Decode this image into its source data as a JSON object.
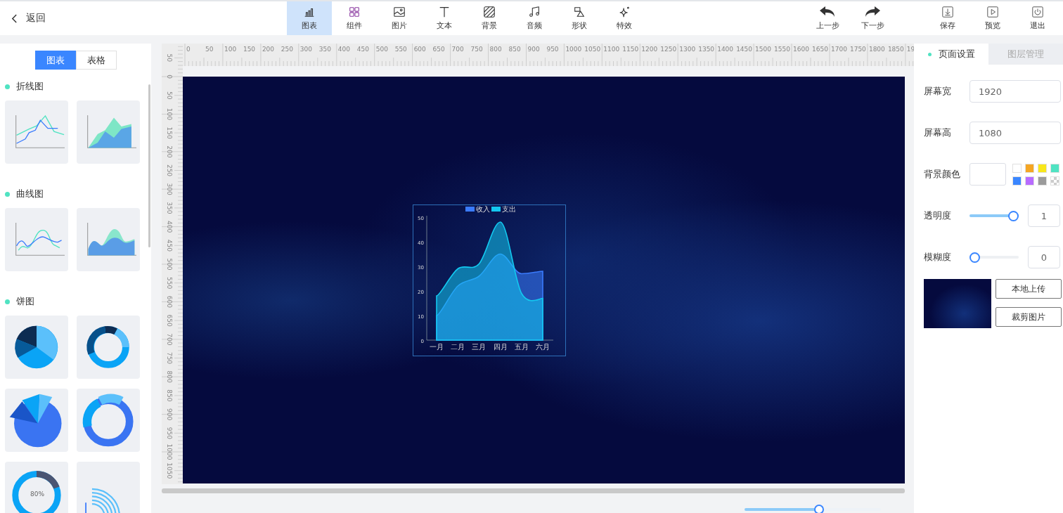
{
  "top_bar": {
    "back": {
      "label": "返回"
    },
    "tools": [
      {
        "label": "图表",
        "kind": "chart",
        "selected": true
      },
      {
        "label": "组件",
        "kind": "widgets",
        "selected": false
      },
      {
        "label": "图片",
        "kind": "image",
        "selected": false
      },
      {
        "label": "文本",
        "kind": "text",
        "selected": false
      },
      {
        "label": "背景",
        "kind": "background",
        "selected": false
      },
      {
        "label": "音频",
        "kind": "audio",
        "selected": false
      },
      {
        "label": "形状",
        "kind": "shape",
        "selected": false
      },
      {
        "label": "特效",
        "kind": "effect",
        "selected": false
      }
    ],
    "history": [
      {
        "label": "上一步",
        "kind": "undo"
      },
      {
        "label": "下一步",
        "kind": "redo"
      }
    ],
    "actions": [
      {
        "label": "保存",
        "kind": "save"
      },
      {
        "label": "预览",
        "kind": "preview"
      },
      {
        "label": "退出",
        "kind": "exit"
      }
    ]
  },
  "left_panel": {
    "tabs": [
      {
        "label": "图表",
        "selected": true
      },
      {
        "label": "表格",
        "selected": false
      }
    ],
    "sections": [
      {
        "title": "折线图",
        "thumbnails": [
          {
            "kind": "line"
          },
          {
            "kind": "line-area"
          }
        ]
      },
      {
        "title": "曲线图",
        "thumbnails": [
          {
            "kind": "curve"
          },
          {
            "kind": "curve-area"
          }
        ]
      },
      {
        "title": "饼图",
        "thumbnails": [
          {
            "kind": "pie"
          },
          {
            "kind": "ring"
          },
          {
            "kind": "rose"
          },
          {
            "kind": "rose-ring"
          },
          {
            "kind": "gauge",
            "text": "80%"
          },
          {
            "kind": "arcs"
          }
        ]
      }
    ]
  },
  "ruler": {
    "top_labels": [
      "0",
      "50",
      "100",
      "150",
      "200",
      "250",
      "300",
      "350",
      "400",
      "450",
      "500",
      "550",
      "600",
      "650",
      "700",
      "750",
      "800",
      "850",
      "900",
      "950",
      "1000",
      "1050",
      "1100",
      "1150",
      "1200",
      "1250",
      "1300",
      "1350",
      "1400",
      "1450",
      "1500",
      "1550",
      "1600",
      "1650",
      "1700",
      "1750",
      "1800",
      "1850",
      "19"
    ],
    "side_labels": [
      "50",
      "0",
      "50",
      "100",
      "150",
      "200",
      "250",
      "300",
      "350",
      "400",
      "450",
      "500",
      "550",
      "600",
      "650",
      "700",
      "750",
      "800",
      "850",
      "900",
      "950",
      "1000",
      "1050"
    ]
  },
  "canvas": {
    "chart": {
      "chart_data": {
        "type": "area",
        "categories": [
          "一月",
          "二月",
          "三月",
          "四月",
          "五月",
          "六月"
        ],
        "series": [
          {
            "name": "收入",
            "color": "#3a7bfd",
            "values": [
              10,
              22,
              26,
              35,
              27,
              28
            ]
          },
          {
            "name": "支出",
            "color": "#13c8f0",
            "values": [
              18,
              29,
              31,
              48,
              19,
              17
            ]
          }
        ],
        "legend": "top",
        "ylim": [
          0,
          50
        ],
        "yticks": [
          0,
          10,
          20,
          30,
          40,
          50
        ]
      }
    }
  },
  "zoom_slider": {
    "level": 0.55
  },
  "right_panel": {
    "tabs": [
      {
        "label": "页面设置",
        "selected": true
      },
      {
        "label": "图层管理",
        "selected": false
      }
    ],
    "fields": [
      {
        "kind": "input",
        "label": "屏幕宽",
        "value": "1920"
      },
      {
        "kind": "input",
        "label": "屏幕高",
        "value": "1080"
      },
      {
        "kind": "color",
        "label": "背景颜色",
        "swatches": [
          {
            "kind": "color",
            "color": "#ffffff"
          },
          {
            "kind": "color",
            "color": "#f5a623"
          },
          {
            "kind": "color",
            "color": "#f8e71c"
          },
          {
            "kind": "color",
            "color": "#50e3c2"
          },
          {
            "kind": "color",
            "color": "#3a86ff"
          },
          {
            "kind": "color",
            "color": "#b86bff"
          },
          {
            "kind": "color",
            "color": "#9b9b9b"
          },
          {
            "kind": "transparent"
          }
        ]
      },
      {
        "kind": "slider",
        "label": "透明度",
        "level": 1,
        "value": "1"
      },
      {
        "kind": "slider",
        "label": "模糊度",
        "level": 0,
        "value": "0"
      }
    ],
    "image_buttons": [
      "本地上传",
      "裁剪图片"
    ]
  }
}
